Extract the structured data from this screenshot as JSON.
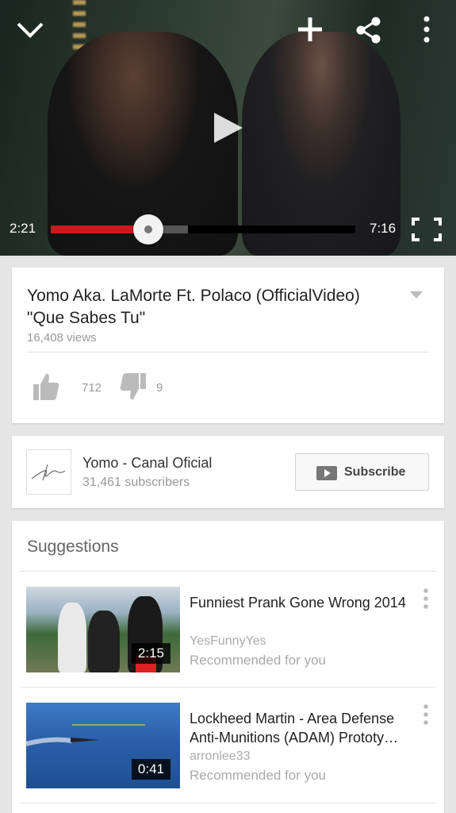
{
  "player": {
    "elapsed": "2:21",
    "duration": "7:16",
    "progress_fraction": 0.32,
    "buffered_fraction": 0.45,
    "accent_color": "#cc181e"
  },
  "icons": {
    "minimize": "chevron-down-icon",
    "add": "plus-icon",
    "share": "share-icon",
    "more": "more-vert-icon",
    "play": "play-icon",
    "fullscreen": "fullscreen-icon"
  },
  "video": {
    "title": "Yomo Aka. LaMorte Ft. Polaco (OfficialVideo) \"Que Sabes Tu\"",
    "views": "16,408 views",
    "likes": "712",
    "dislikes": "9"
  },
  "channel": {
    "name": "Yomo - Canal Oficial",
    "subscribers": "31,461 subscribers",
    "subscribe_label": "Subscribe"
  },
  "suggestions": {
    "heading": "Suggestions",
    "items": [
      {
        "title": "Funniest Prank Gone Wrong 2014",
        "channel": "YesFunnyYes",
        "reason": "Recommended for you",
        "duration": "2:15"
      },
      {
        "title": "Lockheed Martin - Area Defense Anti-Munitions (ADAM) Prototy…",
        "channel": "arronlee33",
        "reason": "Recommended for you",
        "duration": "0:41"
      }
    ]
  }
}
